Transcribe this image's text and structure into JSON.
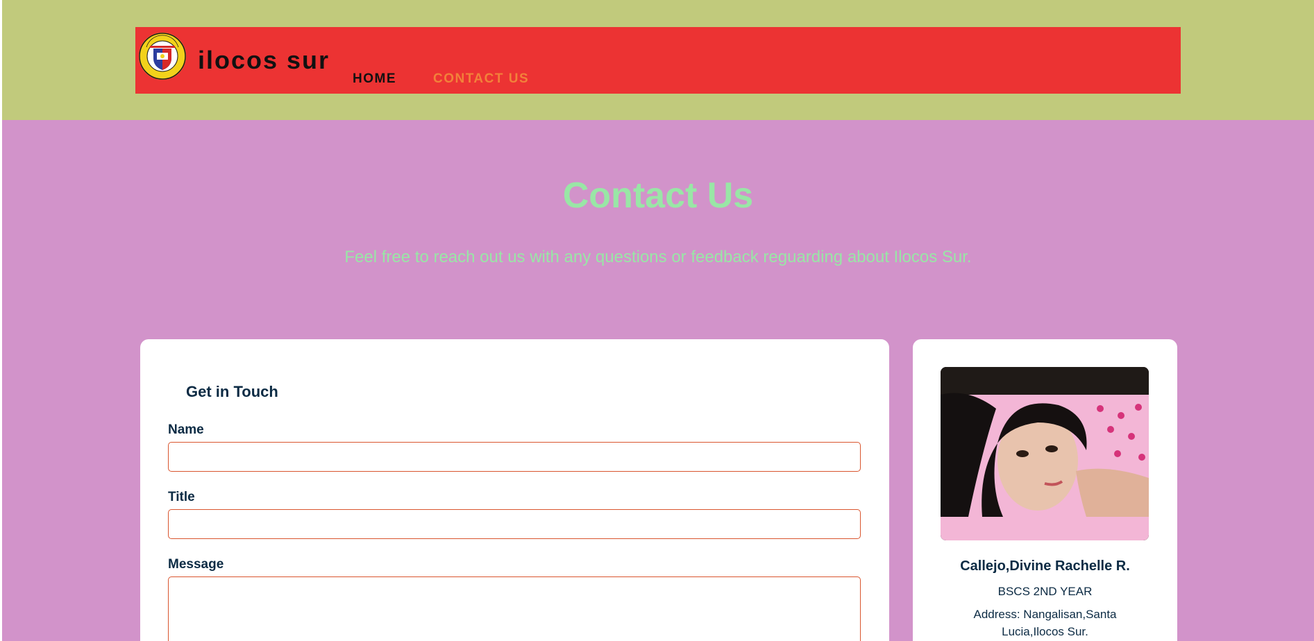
{
  "header": {
    "brand": "ilocos sur",
    "seal_alt": "Province of Ilocos Sur Official Seal",
    "nav": [
      {
        "label": "HOME"
      },
      {
        "label": "CONTACT US"
      }
    ]
  },
  "hero": {
    "title": "Contact Us",
    "subtitle": "Feel free to reach out us with any questions or feedback reguarding about Ilocos Sur."
  },
  "form": {
    "title": "Get in Touch",
    "fields": [
      {
        "label": "Name",
        "value": ""
      },
      {
        "label": "Title",
        "value": ""
      },
      {
        "label": "Message",
        "value": ""
      }
    ]
  },
  "profile": {
    "name": "Callejo,Divine Rachelle R.",
    "course": "BSCS 2ND YEAR",
    "address": "Address: Nangalisan,Santa Lucia,Ilocos Sur."
  },
  "colors": {
    "topband": "#c1ca7c",
    "navbar": "#ec3333",
    "page_bg": "#d293ca",
    "hero_text": "#99e6a6",
    "active_nav": "#f2813a",
    "input_border": "#d9552e",
    "dark_text": "#0c2b44"
  }
}
